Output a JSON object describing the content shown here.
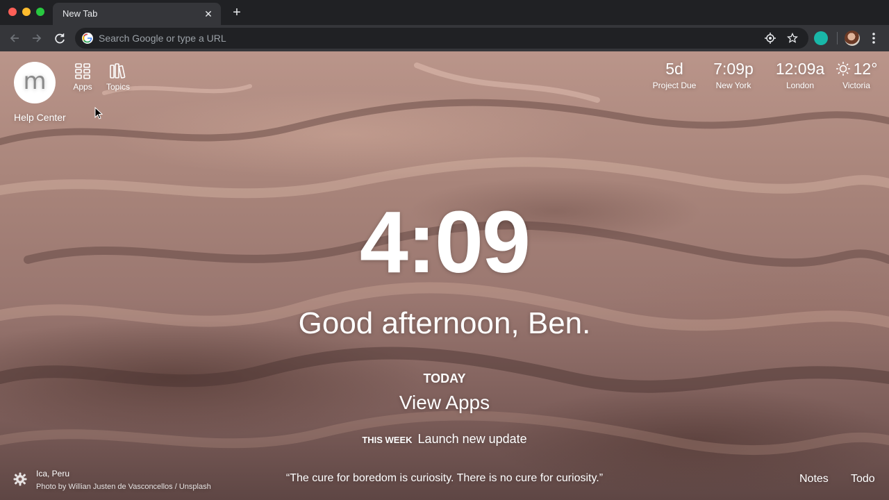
{
  "browser": {
    "tab_title": "New Tab",
    "tab_close_glyph": "✕",
    "new_tab_glyph": "+",
    "omnibox_placeholder": "Search Google or type a URL"
  },
  "dashboard": {
    "logo_letter": "m",
    "help_label": "Help Center",
    "quick_links": [
      {
        "label": "Apps",
        "icon": "apps-grid-icon"
      },
      {
        "label": "Topics",
        "icon": "topics-books-icon"
      }
    ],
    "widgets": {
      "countdown": {
        "value": "5d",
        "label": "Project Due"
      },
      "clock_ny": {
        "value": "7:09p",
        "label": "New York"
      },
      "clock_london": {
        "value": "12:09a",
        "label": "London"
      },
      "weather": {
        "value": "12°",
        "label": "Victoria",
        "icon": "sun-icon"
      }
    },
    "time": "4:09",
    "greeting": "Good afternoon, Ben.",
    "today_label": "TODAY",
    "today_focus": "View Apps",
    "week_label": "THIS WEEK",
    "week_focus": "Launch new update",
    "photo_location": "Ica, Peru",
    "photo_credit": "Photo by Willian Justen de Vasconcellos / Unsplash",
    "quote": "“The cure for boredom is curiosity. There is no cure for curiosity.”",
    "notes_label": "Notes",
    "todo_label": "Todo"
  },
  "colors": {
    "accent_extension": "#19b7a8",
    "chrome_dark": "#202124",
    "chrome_toolbar": "#35363a"
  }
}
